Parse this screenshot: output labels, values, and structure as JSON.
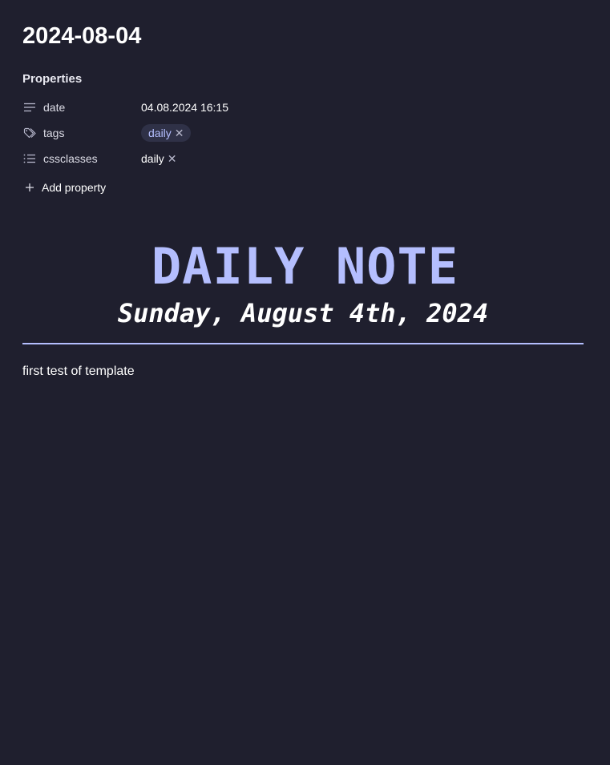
{
  "note": {
    "title": "2024-08-04"
  },
  "properties": {
    "heading": "Properties",
    "items": [
      {
        "icon": "text-lines-icon",
        "key": "date",
        "value": "04.08.2024 16:15"
      },
      {
        "icon": "tags-icon",
        "key": "tags",
        "tags": [
          "daily"
        ]
      },
      {
        "icon": "list-icon",
        "key": "cssclasses",
        "tags": [
          "daily"
        ]
      }
    ],
    "add_label": "Add property"
  },
  "banner": {
    "title": "DAILY NOTE",
    "date": "Sunday, August 4th, 2024"
  },
  "content": {
    "text": "first test of template"
  },
  "colors": {
    "background": "#1f1f2e",
    "accent": "#b4befe",
    "tag_pill": "#2f3147",
    "text": "#ffffff"
  }
}
